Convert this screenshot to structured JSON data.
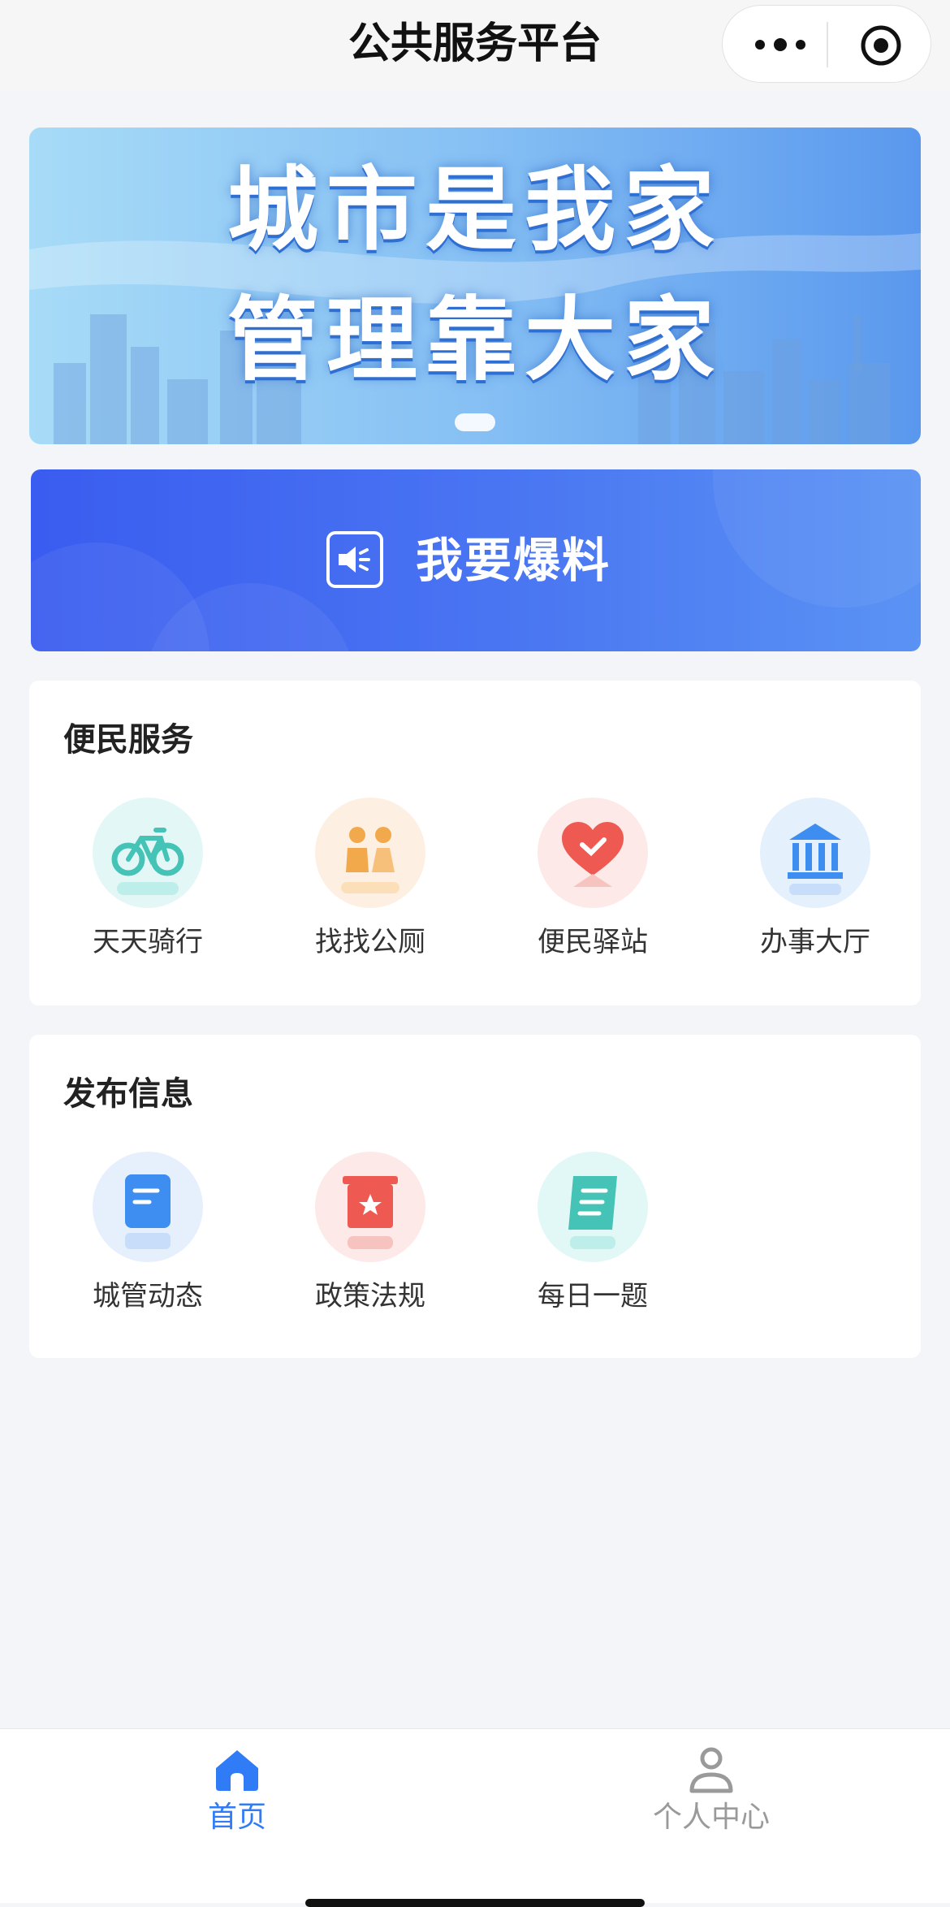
{
  "header": {
    "title": "公共服务平台"
  },
  "banner": {
    "line1": "城市是我家",
    "line2": "管理靠大家"
  },
  "report": {
    "label": "我要爆料"
  },
  "convenience": {
    "title": "便民服务",
    "items": [
      {
        "label": "天天骑行",
        "icon": "bicycle-icon"
      },
      {
        "label": "找找公厕",
        "icon": "restroom-icon"
      },
      {
        "label": "便民驿站",
        "icon": "heart-icon"
      },
      {
        "label": "办事大厅",
        "icon": "government-building-icon"
      }
    ]
  },
  "publish": {
    "title": "发布信息",
    "items": [
      {
        "label": "城管动态",
        "icon": "document-icon"
      },
      {
        "label": "政策法规",
        "icon": "policy-scroll-icon"
      },
      {
        "label": "每日一题",
        "icon": "daily-quiz-icon"
      }
    ]
  },
  "tabbar": {
    "home": "首页",
    "me": "个人中心"
  },
  "colors": {
    "accent": "#2f7cf6",
    "report_bg": "#3a5cf0",
    "inactive": "#9a9a9a"
  }
}
